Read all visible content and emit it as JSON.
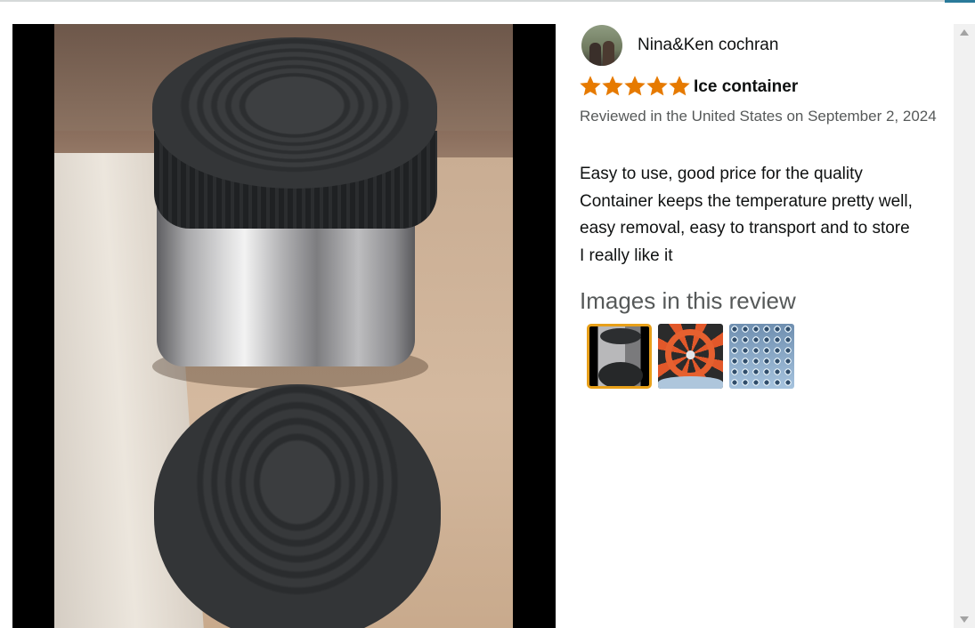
{
  "review": {
    "reviewer_name": "Nina&Ken cochran",
    "rating": 5,
    "rating_max": 5,
    "star_color": "#e67a00",
    "title": "Ice container",
    "date_line": "Reviewed in the United States on September 2, 2024",
    "body_lines": [
      "Easy to use, good price for the quality",
      "Container keeps the temperature pretty well,",
      "easy removal, easy to transport and to store",
      "I really like it"
    ]
  },
  "images_section": {
    "heading": "Images in this review",
    "thumbnails": [
      {
        "subject": "stainless container with lid",
        "selected": true
      },
      {
        "subject": "orange ice tray",
        "selected": false
      },
      {
        "subject": "blue hexagon ice tray",
        "selected": false
      }
    ],
    "selected_border_color": "#e8a019"
  },
  "viewer": {
    "subject": "stainless steel ice container with black lids"
  }
}
